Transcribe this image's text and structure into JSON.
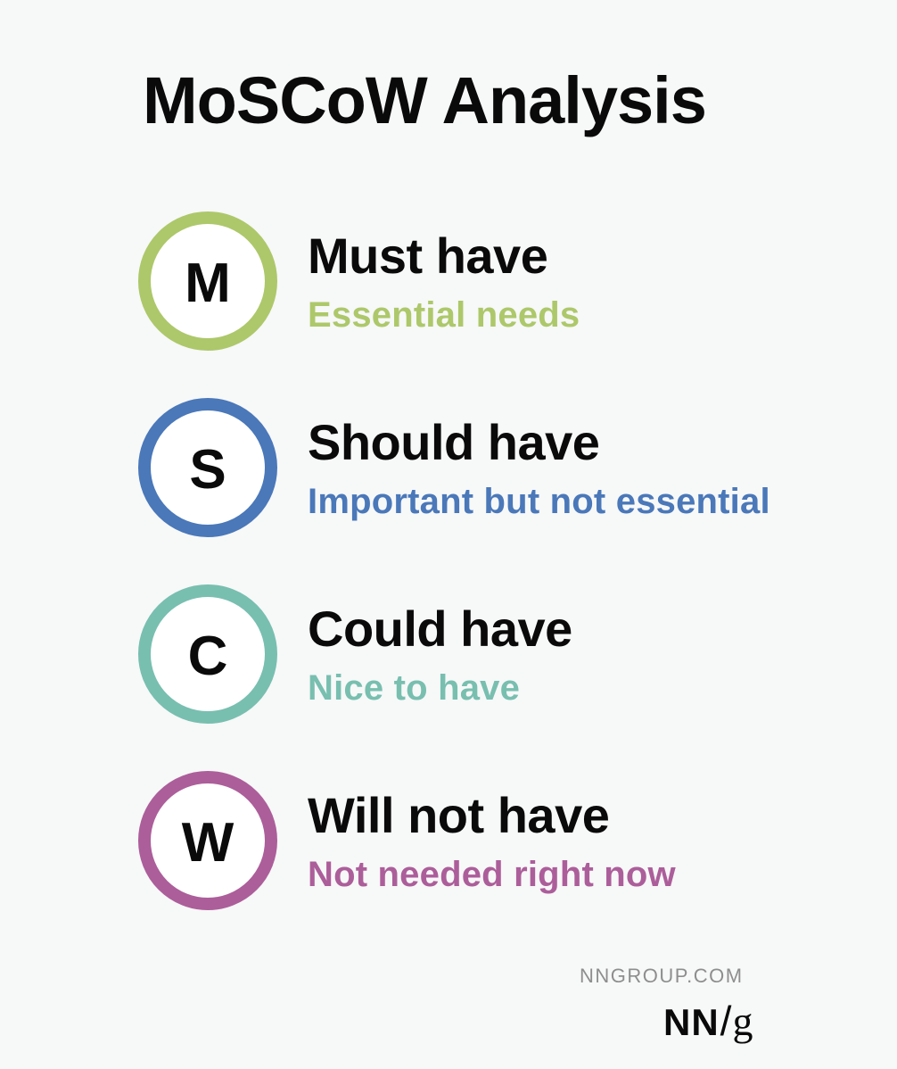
{
  "title": "MoSCoW Analysis",
  "colors": {
    "background": "#f7f8f8",
    "must": "#adc86a",
    "should": "#4a78b9",
    "could": "#78bfb0",
    "will_not": "#ac5e9a"
  },
  "items": [
    {
      "letter": "M",
      "label": "Must have",
      "description": "Essential needs",
      "color": "#adc86a"
    },
    {
      "letter": "S",
      "label": "Should have",
      "description": "Important but not essential",
      "color": "#4a78b9"
    },
    {
      "letter": "C",
      "label": "Could have",
      "description": "Nice to have",
      "color": "#78bfb0"
    },
    {
      "letter": "W",
      "label": "Will not have",
      "description": "Not needed right now",
      "color": "#ac5e9a"
    }
  ],
  "footer": {
    "site": "NNGROUP.COM",
    "logo_nn": "NN",
    "logo_slash": "/",
    "logo_g": "g"
  }
}
